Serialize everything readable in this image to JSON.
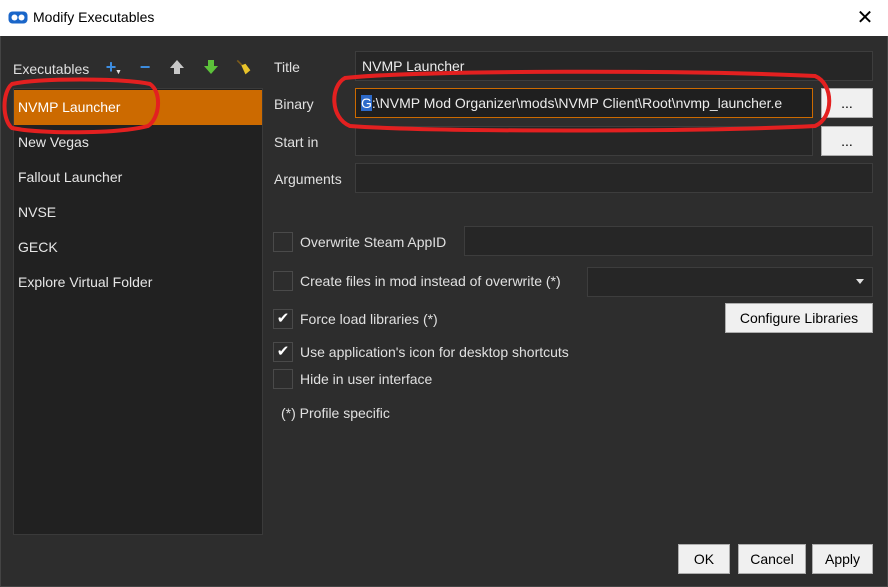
{
  "window": {
    "title": "Modify Executables",
    "close_glyph": "✕",
    "app_icon": "mod-organizer-icon"
  },
  "executables": {
    "label": "Executables",
    "toolbar": {
      "add_glyph": "+",
      "remove_glyph": "−",
      "up_icon": "arrow-up-icon",
      "down_icon": "arrow-down-icon",
      "clean_icon": "broom-icon"
    },
    "items": [
      {
        "label": "NVMP Launcher",
        "selected": true
      },
      {
        "label": "New Vegas",
        "selected": false
      },
      {
        "label": "Fallout Launcher",
        "selected": false
      },
      {
        "label": "NVSE",
        "selected": false
      },
      {
        "label": "GECK",
        "selected": false
      },
      {
        "label": "Explore Virtual Folder",
        "selected": false
      }
    ]
  },
  "form": {
    "title_label": "Title",
    "title_value": "NVMP Launcher",
    "binary_label": "Binary",
    "binary_value_selected": "G",
    "binary_value_rest": ":\\NVMP Mod Organizer\\mods\\NVMP Client\\Root\\nvmp_launcher.e",
    "browse_label": "...",
    "start_in_label": "Start in",
    "start_in_value": "",
    "arguments_label": "Arguments",
    "arguments_value": ""
  },
  "options": {
    "overwrite_appid": {
      "label": "Overwrite Steam AppID",
      "checked": false,
      "value": ""
    },
    "create_in_mod": {
      "label": "Create files in mod instead of overwrite (*)",
      "checked": false,
      "value": ""
    },
    "force_load": {
      "label": "Force load libraries (*)",
      "checked": true
    },
    "configure_libraries_label": "Configure Libraries",
    "use_app_icon": {
      "label": "Use application's icon for desktop shortcuts",
      "checked": true
    },
    "hide_in_ui": {
      "label": "Hide in user interface",
      "checked": false
    },
    "profile_note": "(*) Profile specific",
    "check_glyph": "✔"
  },
  "footer": {
    "ok_label": "OK",
    "cancel_label": "Cancel",
    "apply_label": "Apply"
  },
  "colors": {
    "accent": "#cc6a00",
    "annotation": "#e32020",
    "selection_blue": "#2d6ac9"
  }
}
